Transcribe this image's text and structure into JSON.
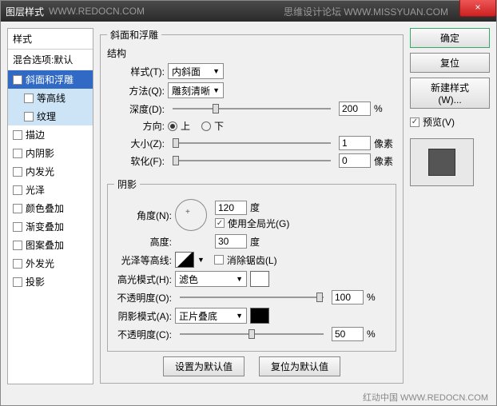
{
  "window": {
    "title": "图层样式",
    "left_watermark": "WWW.REDOCN.COM",
    "right_watermark": "思维设计论坛 WWW.MISSYUAN.COM",
    "close_label": "×"
  },
  "left": {
    "header": "样式",
    "blend": "混合选项:默认",
    "items": [
      {
        "label": "斜面和浮雕",
        "checked": true,
        "selected": true
      },
      {
        "label": "等高线",
        "checked": false,
        "sub": true
      },
      {
        "label": "纹理",
        "checked": false,
        "sub": true
      },
      {
        "label": "描边",
        "checked": false
      },
      {
        "label": "内阴影",
        "checked": false
      },
      {
        "label": "内发光",
        "checked": false
      },
      {
        "label": "光泽",
        "checked": false
      },
      {
        "label": "颜色叠加",
        "checked": false
      },
      {
        "label": "渐变叠加",
        "checked": false
      },
      {
        "label": "图案叠加",
        "checked": false
      },
      {
        "label": "外发光",
        "checked": false
      },
      {
        "label": "投影",
        "checked": false
      }
    ]
  },
  "bevel": {
    "group_title": "斜面和浮雕",
    "structure_title": "结构",
    "style_label": "样式(T):",
    "style_value": "内斜面",
    "technique_label": "方法(Q):",
    "technique_value": "雕刻清晰",
    "depth_label": "深度(D):",
    "depth_value": "200",
    "percent": "%",
    "direction_label": "方向:",
    "direction_up": "上",
    "direction_down": "下",
    "size_label": "大小(Z):",
    "size_value": "1",
    "pixel_unit": "像素",
    "soften_label": "软化(F):",
    "soften_value": "0"
  },
  "shading": {
    "title": "阴影",
    "angle_label": "角度(N):",
    "angle_value": "120",
    "degree": "度",
    "global_light": "使用全局光(G)",
    "altitude_label": "高度:",
    "altitude_value": "30",
    "gloss_label": "光泽等高线:",
    "antialiased": "消除锯齿(L)",
    "highlight_mode_label": "高光模式(H):",
    "highlight_mode_value": "滤色",
    "highlight_opacity_label": "不透明度(O):",
    "highlight_opacity_value": "100",
    "shadow_mode_label": "阴影模式(A):",
    "shadow_mode_value": "正片叠底",
    "shadow_opacity_label": "不透明度(C):",
    "shadow_opacity_value": "50"
  },
  "buttons": {
    "set_default": "设置为默认值",
    "reset_default": "复位为默认值",
    "ok": "确定",
    "reset": "复位",
    "new_style": "新建样式(W)...",
    "preview": "预览(V)"
  },
  "footer_watermark": "红动中国 WWW.REDOCN.COM"
}
